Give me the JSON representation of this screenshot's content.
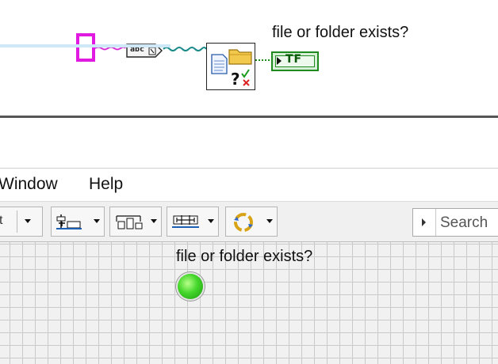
{
  "block_diagram": {
    "indicator_label": "file or folder exists?",
    "indicator_text": "TF",
    "to_path_text": "abc"
  },
  "menu": {
    "items": [
      "Window",
      "Help"
    ]
  },
  "toolbar": {
    "buttons": [
      "partial-button-icon",
      "align-objects-icon",
      "distribute-objects-icon",
      "resize-objects-icon",
      "reorder-icon"
    ],
    "search_placeholder": "Search"
  },
  "front_panel": {
    "indicator_label": "file or folder exists?",
    "led_state": "on",
    "led_color": "#43d62a"
  }
}
